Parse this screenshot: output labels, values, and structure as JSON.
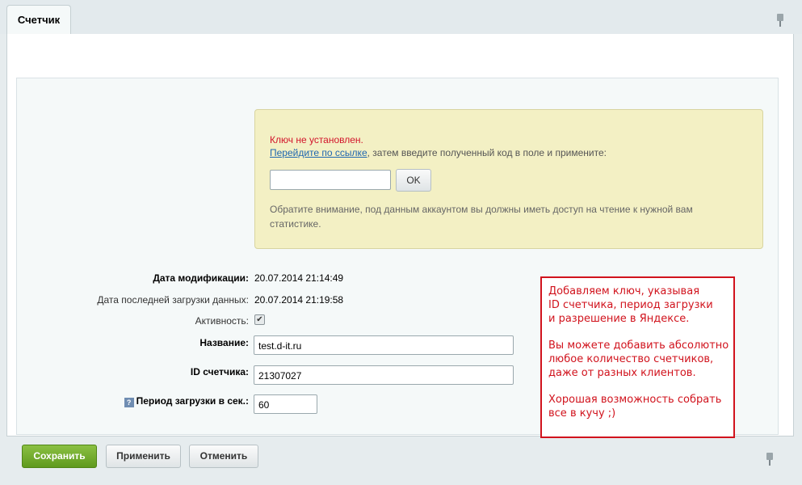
{
  "tab": {
    "label": "Счетчик"
  },
  "notice": {
    "title": "Ключ не установлен.",
    "link_text": "Перейдите по ссылке",
    "instruction": ", затем введите полученный код в поле и примените:",
    "key_input_value": "",
    "ok_label": "OK",
    "note": "Обратите внимание, под данным аккаунтом вы должны иметь доступ на чтение к нужной вам статистике."
  },
  "form": {
    "modified_label": "Дата модификации:",
    "modified_value": "20.07.2014 21:14:49",
    "last_load_label": "Дата последней загрузки данных:",
    "last_load_value": "20.07.2014 21:19:58",
    "active_label": "Активность:",
    "active_checked": true,
    "active_mark": "✔",
    "name_label": "Название:",
    "name_value": "test.d-it.ru",
    "counter_id_label": "ID счетчика:",
    "counter_id_value": "21307027",
    "period_help": "?",
    "period_label": "Период загрузки в сек.:",
    "period_value": "60"
  },
  "annotation": {
    "para1": " Добавляем ключ, указывая\nID счетчика, период загрузки\nи разрешение в Яндексе.",
    "para2": "Вы можете добавить абсолютно\nлюбое количество счетчиков,\nдаже от разных клиентов.",
    "para3": "Хорошая возможность собрать\nвсе в кучу ;)"
  },
  "buttons": {
    "save": "Сохранить",
    "apply": "Применить",
    "cancel": "Отменить"
  }
}
